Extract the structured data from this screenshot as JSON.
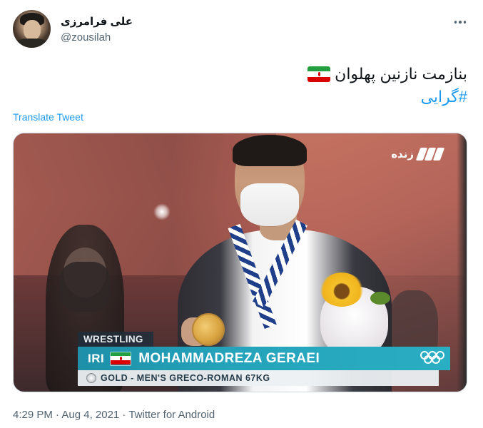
{
  "user": {
    "display_name": "علی فرامرزی",
    "handle": "@zousilah"
  },
  "header": {
    "more_icon": "more-horizontal-icon"
  },
  "tweet": {
    "text_line1": "بنازمت نازنین پهلوان",
    "flag_icon": "iran-flag-icon",
    "hashtag": "#گرایی"
  },
  "translate_label": "Translate Tweet",
  "media": {
    "channel_text": "زنده",
    "lower_third": {
      "sport": "WRESTLING",
      "country": "IRI",
      "athlete": "MOHAMMADREZA GERAEI",
      "result": "GOLD - MEN'S GRECO-ROMAN 67KG"
    }
  },
  "meta": {
    "timestamp": "4:29 PM · Aug 4, 2021 · Twitter for Android"
  },
  "colors": {
    "link": "#1d9bf0",
    "secondary_text": "#536471",
    "primary_text": "#0f1419",
    "banner_teal": "#24a3bb"
  }
}
